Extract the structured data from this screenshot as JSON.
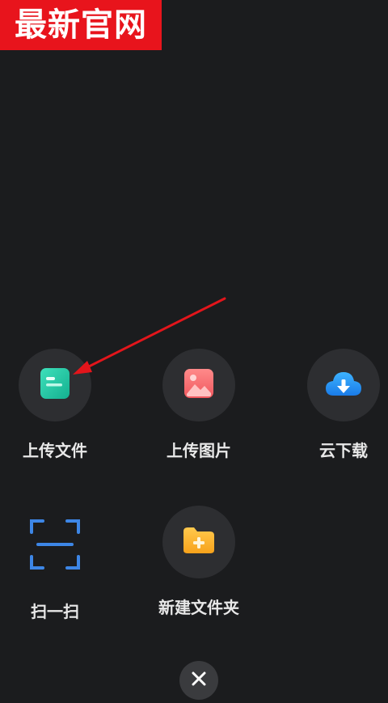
{
  "watermark": {
    "text": "最新官网"
  },
  "actions": [
    {
      "label": "上传文件",
      "icon": "document-icon"
    },
    {
      "label": "上传图片",
      "icon": "image-icon"
    },
    {
      "label": "云下载",
      "icon": "cloud-download-icon"
    },
    {
      "label": "扫一扫",
      "icon": "scan-icon"
    },
    {
      "label": "新建文件夹",
      "icon": "new-folder-icon"
    }
  ],
  "close_button": {
    "icon": "close-icon"
  },
  "colors": {
    "background": "#1b1c1e",
    "circle": "#2d2e31",
    "watermark": "#e8141c",
    "annotation_arrow": "#e3151b"
  }
}
